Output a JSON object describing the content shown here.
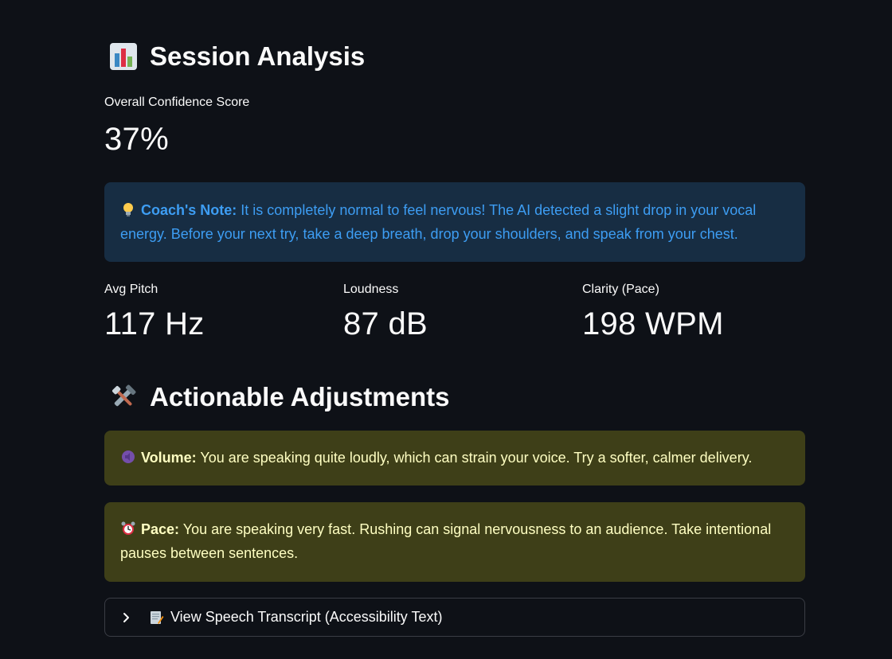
{
  "session": {
    "title": "Session Analysis",
    "icon": "bar-chart-icon",
    "score_label": "Overall Confidence Score",
    "score_value": "37%"
  },
  "coach_note": {
    "icon": "lightbulb-icon",
    "title": "Coach's Note:",
    "text": " It is completely normal to feel nervous! The AI detected a slight drop in your vocal energy. Before your next try, take a deep breath, drop your shoulders, and speak from your chest."
  },
  "metrics": [
    {
      "label": "Avg Pitch",
      "value": "117 Hz"
    },
    {
      "label": "Loudness",
      "value": "87 dB"
    },
    {
      "label": "Clarity (Pace)",
      "value": "198 WPM"
    }
  ],
  "adjustments": {
    "title": "Actionable Adjustments",
    "icon": "tools-icon",
    "items": [
      {
        "icon": "speaker-icon",
        "title": "Volume:",
        "text": " You are speaking quite loudly, which can strain your voice. Try a softer, calmer delivery."
      },
      {
        "icon": "alarm-clock-icon",
        "title": "Pace:",
        "text": " You are speaking very fast. Rushing can signal nervousness to an audience. Take intentional pauses between sentences."
      }
    ]
  },
  "expander": {
    "label": "View Speech Transcript (Accessibility Text)",
    "icon": "memo-icon"
  },
  "colors": {
    "background": "#0e1117",
    "info_bg": "#172d43",
    "info_text": "#3d9df3",
    "warn_bg": "#3e3f18",
    "warn_text": "#ffffc2"
  }
}
